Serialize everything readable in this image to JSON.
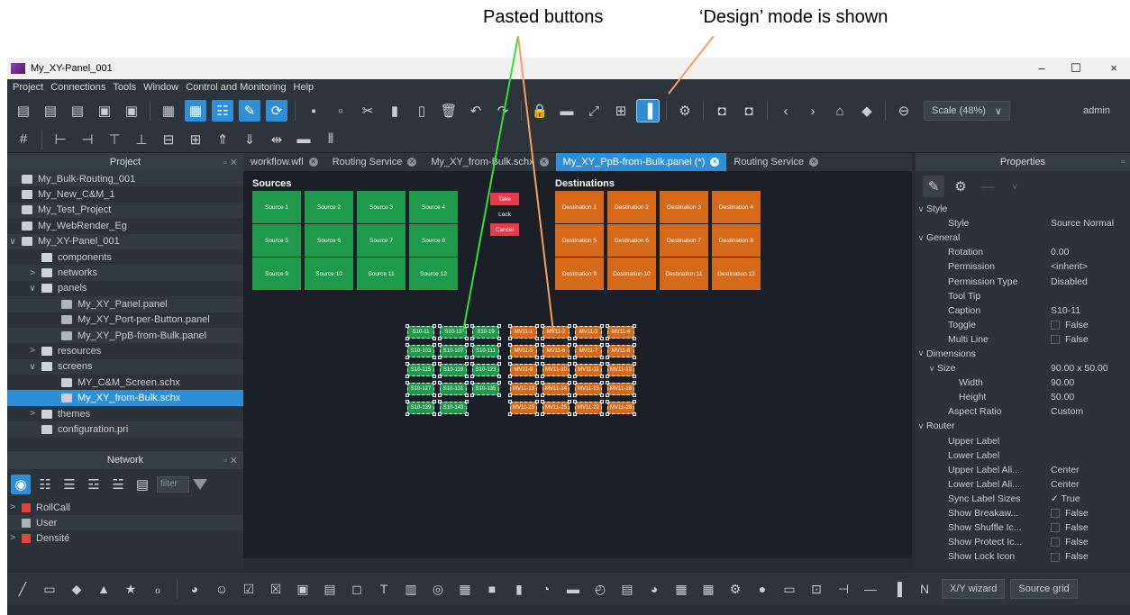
{
  "annotations": {
    "pasted_buttons": "Pasted buttons",
    "design_mode": "‘Design’ mode is shown"
  },
  "window": {
    "title": "My_XY-Panel_001",
    "minimize": "–",
    "maximize": "☐",
    "close": "×"
  },
  "menu": [
    "Project",
    "Connections",
    "Tools",
    "Window",
    "Control and Monitoring",
    "Help"
  ],
  "toolbar": {
    "scale": "Scale (48%)",
    "user": "admin"
  },
  "project": {
    "title": "Project",
    "items": [
      {
        "label": "My_Bulk-Routing_001",
        "depth": 0,
        "chev": "",
        "type": "project"
      },
      {
        "label": "My_New_C&M_1",
        "depth": 0,
        "chev": "",
        "type": "project"
      },
      {
        "label": "My_Test_Project",
        "depth": 0,
        "chev": "",
        "type": "project"
      },
      {
        "label": "My_WebRender_Eg",
        "depth": 0,
        "chev": "",
        "type": "project"
      },
      {
        "label": "My_XY-Panel_001",
        "depth": 0,
        "chev": "∨",
        "type": "project"
      },
      {
        "label": "components",
        "depth": 1,
        "chev": "",
        "type": "folder"
      },
      {
        "label": "networks",
        "depth": 1,
        "chev": ">",
        "type": "folder"
      },
      {
        "label": "panels",
        "depth": 1,
        "chev": "∨",
        "type": "folder"
      },
      {
        "label": "My_XY_Panel.panel",
        "depth": 2,
        "chev": "",
        "type": "panel"
      },
      {
        "label": "My_XY_Port-per-Button.panel",
        "depth": 2,
        "chev": "",
        "type": "panel"
      },
      {
        "label": "My_XY_PpB-from-Bulk.panel",
        "depth": 2,
        "chev": "",
        "type": "panel"
      },
      {
        "label": "resources",
        "depth": 1,
        "chev": ">",
        "type": "folder"
      },
      {
        "label": "screens",
        "depth": 1,
        "chev": "∨",
        "type": "folder"
      },
      {
        "label": "MY_C&M_Screen.schx",
        "depth": 2,
        "chev": "",
        "type": "screen"
      },
      {
        "label": "My_XY_from-Bulk.schx",
        "depth": 2,
        "chev": "",
        "type": "screen",
        "selected": true
      },
      {
        "label": "themes",
        "depth": 1,
        "chev": ">",
        "type": "folder"
      },
      {
        "label": "configuration.pri",
        "depth": 1,
        "chev": "",
        "type": "project"
      }
    ]
  },
  "network": {
    "title": "Network",
    "filter_placeholder": "filter",
    "items": [
      {
        "label": "RollCall",
        "chev": ">",
        "color": "#e0453a"
      },
      {
        "label": "User",
        "chev": "",
        "color": "#aab2b9"
      },
      {
        "label": "Densité",
        "chev": ">",
        "color": "#e0453a"
      }
    ]
  },
  "tabs": [
    {
      "label": "workflow.wfl",
      "active": false
    },
    {
      "label": "Routing Service",
      "active": false
    },
    {
      "label": "My_XY_from-Bulk.schx",
      "active": false
    },
    {
      "label": "My_XY_PpB-from-Bulk.panel (*)",
      "active": true
    },
    {
      "label": "Routing Service",
      "active": false
    }
  ],
  "panel": {
    "sources_title": "Sources",
    "destinations_title": "Destinations",
    "sources": [
      "Source 1",
      "Source 2",
      "Source 3",
      "Source 4",
      "Source 5",
      "Source 6",
      "Source 7",
      "Source 8",
      "Source 9",
      "Source 10",
      "Source 11",
      "Source 12"
    ],
    "destinations": [
      "Destination 1",
      "Destination 2",
      "Destination 3",
      "Destination 4",
      "Destination 5",
      "Destination 6",
      "Destination 7",
      "Destination 8",
      "Destination 9",
      "Destination 10",
      "Destination 11",
      "Destination 12"
    ],
    "take": "Take",
    "lock": "Lock",
    "cancel": "Cancel",
    "pasted_sources": [
      "S10-11",
      "S10-15",
      "S10-19",
      "S10-103",
      "S10-107",
      "S10-111",
      "S10-115",
      "S10-119",
      "S10-123",
      "S10-127",
      "S10-131",
      "S10-135",
      "S10-139",
      "S10-143"
    ],
    "pasted_destinations": [
      "MV11-1",
      "MV11-2",
      "MV11-3",
      "MV11-4",
      "MV11-5",
      "MV11-6",
      "MV11-7",
      "MV11-8",
      "MV11-9",
      "MV11-10",
      "MV11-11",
      "MV11-12",
      "MV11-13",
      "MV11-14",
      "MV11-15",
      "MV11-16",
      "MV11-23",
      "MV11-25",
      "MV11-22",
      "MV11-28"
    ]
  },
  "properties": {
    "title": "Properties",
    "rows": [
      {
        "key": "Style",
        "value": "",
        "indent": 0,
        "chev": "∨",
        "section": true
      },
      {
        "key": "Style",
        "value": "Source Normal",
        "indent": 2
      },
      {
        "key": "General",
        "value": "",
        "indent": 0,
        "chev": "∨",
        "section": true
      },
      {
        "key": "Rotation",
        "value": "0.00",
        "indent": 2
      },
      {
        "key": "Permission",
        "value": "<inherit>",
        "indent": 2
      },
      {
        "key": "Permission Type",
        "value": "Disabled",
        "indent": 2
      },
      {
        "key": "Tool Tip",
        "value": "",
        "indent": 2
      },
      {
        "key": "Caption",
        "value": "S10-11",
        "indent": 2
      },
      {
        "key": "Toggle",
        "value": "False",
        "indent": 2,
        "check": true
      },
      {
        "key": "Multi Line",
        "value": "False",
        "indent": 2,
        "check": true
      },
      {
        "key": "Dimensions",
        "value": "",
        "indent": 0,
        "chev": "∨",
        "section": true
      },
      {
        "key": "Size",
        "value": "90.00 x 50.00",
        "indent": 1,
        "chev": "∨"
      },
      {
        "key": "Width",
        "value": "90.00",
        "indent": 3
      },
      {
        "key": "Height",
        "value": "50.00",
        "indent": 3
      },
      {
        "key": "Aspect Ratio",
        "value": "Custom",
        "indent": 2
      },
      {
        "key": "Router",
        "value": "",
        "indent": 0,
        "chev": "∨",
        "section": true
      },
      {
        "key": "Upper Label",
        "value": "",
        "indent": 2
      },
      {
        "key": "Lower Label",
        "value": "",
        "indent": 2
      },
      {
        "key": "Upper Label Ali...",
        "value": "Center",
        "indent": 2
      },
      {
        "key": "Lower Label Ali...",
        "value": "Center",
        "indent": 2
      },
      {
        "key": "Sync Label Sizes",
        "value": "✓ True",
        "indent": 2
      },
      {
        "key": "Show Breakaw...",
        "value": "False",
        "indent": 2,
        "check": true
      },
      {
        "key": "Show Shuffle Ic...",
        "value": "False",
        "indent": 2,
        "check": true
      },
      {
        "key": "Show Protect Ic...",
        "value": "False",
        "indent": 2,
        "check": true
      },
      {
        "key": "Show Lock Icon",
        "value": "False",
        "indent": 2,
        "check": true
      }
    ]
  },
  "bottom": {
    "xy_wizard": "X/Y wizard",
    "source_grid": "Source grid"
  },
  "icons": {
    "toolbar1": [
      "new-icon",
      "import-icon",
      "export-icon",
      "save-icon",
      "save-all-icon",
      "deploy-icon",
      "upload-icon",
      "tree-icon",
      "edit-icon",
      "refresh-icon",
      "grid-icon",
      "grid2-icon",
      "cut-icon",
      "copy-icon",
      "paste-icon",
      "delete-icon",
      "undo-icon",
      "redo-icon",
      "lock-icon",
      "screen-icon",
      "expand-icon",
      "table-icon",
      "design-mode-icon",
      "gear-icon",
      "deploy-a-icon",
      "deploy-b-icon",
      "back-icon",
      "forward-icon",
      "home-icon",
      "tag-icon",
      "zoom-out-icon"
    ],
    "toolbar2": [
      "snap-grid-icon",
      "align-left-icon",
      "align-right-icon",
      "align-top-icon",
      "align-bottom-icon",
      "center-h-icon",
      "center-v-icon",
      "send-up-icon",
      "send-down-icon",
      "space-h-icon",
      "space-v-icon",
      "distribute-icon"
    ]
  }
}
